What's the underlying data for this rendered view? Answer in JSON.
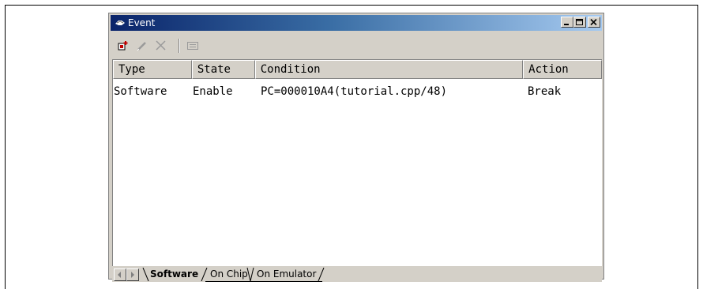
{
  "window": {
    "title": "Event",
    "title_buttons": [
      "minimize",
      "maximize",
      "close"
    ]
  },
  "toolbar": {
    "buttons": [
      {
        "name": "add-event",
        "icon": "new-event-icon"
      },
      {
        "name": "edit-event",
        "icon": "pencil-icon"
      },
      {
        "name": "delete-event",
        "icon": "delete-x-icon"
      },
      {
        "name": "properties",
        "icon": "list-icon"
      }
    ]
  },
  "table": {
    "columns": [
      "Type",
      "State",
      "Condition",
      "Action"
    ],
    "rows": [
      {
        "type": "Software",
        "state": "Enable",
        "condition": "PC=000010A4(tutorial.cpp/48)",
        "action": "Break"
      }
    ]
  },
  "tabs": [
    {
      "label": "Software",
      "active": true
    },
    {
      "label": "On Chip",
      "active": false
    },
    {
      "label": "On Emulator",
      "active": false
    }
  ],
  "colors": {
    "titlebar_start": "#0a246a",
    "titlebar_end": "#a6caf0",
    "face": "#d4d0c8"
  }
}
